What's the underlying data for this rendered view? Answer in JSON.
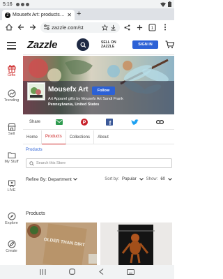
{
  "status_bar": {
    "time": "5:16"
  },
  "browser": {
    "tab_title": "Mousefx Art: products on",
    "url": "zazzle.com/st",
    "tab_count": "1"
  },
  "header": {
    "logo": "Zazzle",
    "sell_line1": "SELL ON",
    "sell_line2": "ZAZZLE",
    "sign_in": "SIGN IN"
  },
  "left_nav": {
    "items": [
      {
        "label": "Gifts"
      },
      {
        "label": "Trending"
      },
      {
        "label": "Sell"
      },
      {
        "label": "My Stuff"
      },
      {
        "label": "LIVE"
      },
      {
        "label": "Explore"
      },
      {
        "label": "Create"
      }
    ]
  },
  "store": {
    "name": "Mousefx Art",
    "follow": "Follow",
    "description": "Art Apparel gifts by Mousefx Art Sandi Frank",
    "location": "Pennsylvania, United States"
  },
  "share": {
    "label": "Share"
  },
  "tabs": [
    {
      "label": "Home"
    },
    {
      "label": "Products"
    },
    {
      "label": "Collections"
    },
    {
      "label": "About"
    }
  ],
  "breadcrumb": "Products",
  "search": {
    "placeholder": "Search this Store"
  },
  "refine": {
    "label": "Refine By:",
    "value": "Department",
    "sort_label": "Sort by:",
    "sort_value": "Popular",
    "show_label": "Show:",
    "show_value": "60"
  },
  "products_title": "Products",
  "product1": {
    "art_text": "OLDER THAN DIRT"
  },
  "colors": {
    "accent_red": "#cc2222",
    "sign_in_blue": "#2c61d6",
    "search_navy": "#1f2a44"
  }
}
